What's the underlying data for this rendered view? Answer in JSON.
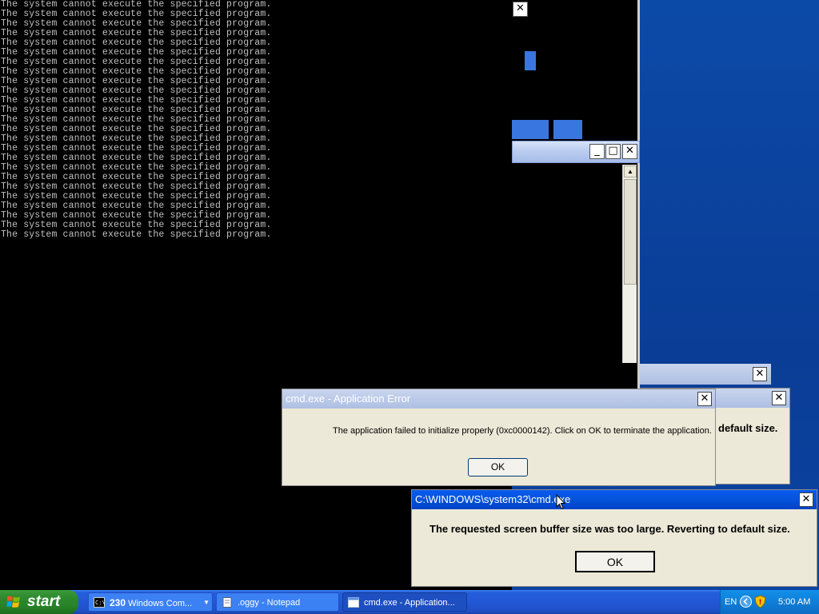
{
  "console": {
    "line_text": "The system cannot execute the specified program.",
    "line_count": 25
  },
  "cascade": {
    "close_glyph": "✕",
    "minimize_glyph": "_",
    "maximize_glyph": "□",
    "scroll_down_glyph": "▼",
    "scroll_up_glyph": "▲"
  },
  "dialog_back": {
    "visible_text": "default size."
  },
  "app_error": {
    "title": "cmd.exe - Application Error",
    "message": "The application failed to initialize properly (0xc0000142). Click on OK to terminate the application.",
    "ok_label": "OK"
  },
  "buffer_error": {
    "title": "C:\\WINDOWS\\system32\\cmd.exe",
    "message": "The requested screen buffer size was too large. Reverting to default size.",
    "ok_label": "OK"
  },
  "taskbar": {
    "start_label": "start",
    "tasks": [
      {
        "count": "230",
        "label": "Windows Com...",
        "icon": "cmd-icon"
      },
      {
        "label": ".oggy - Notepad",
        "icon": "notepad-icon"
      },
      {
        "label": "cmd.exe - Application...",
        "icon": "window-icon"
      }
    ],
    "language": "EN",
    "time": "5:00 AM"
  },
  "colors": {
    "desktop": "#0a3f9e",
    "title_active": "#0453d9",
    "console_text": "#c0c0c0"
  }
}
